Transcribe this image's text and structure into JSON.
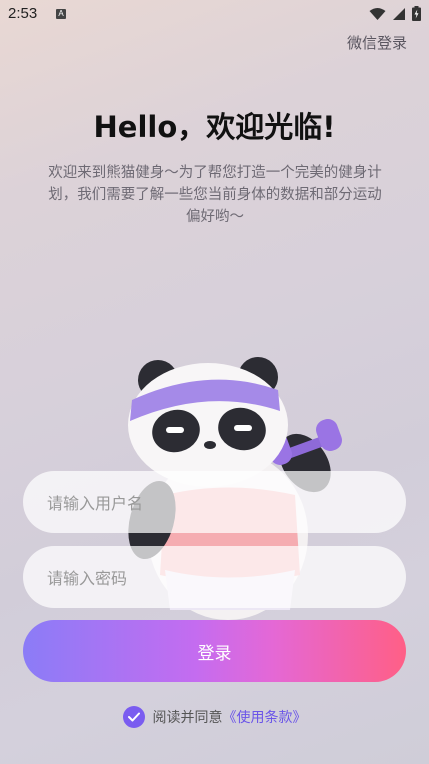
{
  "status_bar": {
    "time": "2:53",
    "notification_icon_letter": "A",
    "icons": [
      "a-icon",
      "wifi-icon",
      "signal-icon",
      "battery-icon"
    ]
  },
  "header": {
    "wechat_login": "微信登录"
  },
  "welcome": {
    "title": "Hello，欢迎光临!",
    "subtitle": "欢迎来到熊猫健身～为了帮您打造一个完美的健身计划，我们需要了解一些您当前身体的数据和部分运动偏好哟～"
  },
  "form": {
    "username_placeholder": "请输入用户名",
    "password_placeholder": "请输入密码",
    "login_label": "登录"
  },
  "agreement": {
    "checked": true,
    "text": "阅读并同意",
    "terms_link": "《使用条款》"
  },
  "colors": {
    "accent": "#7a5cf0",
    "button_gradient_start": "#8b7cf7",
    "button_gradient_end": "#ff5f86",
    "terms_link": "#6b55e8"
  }
}
